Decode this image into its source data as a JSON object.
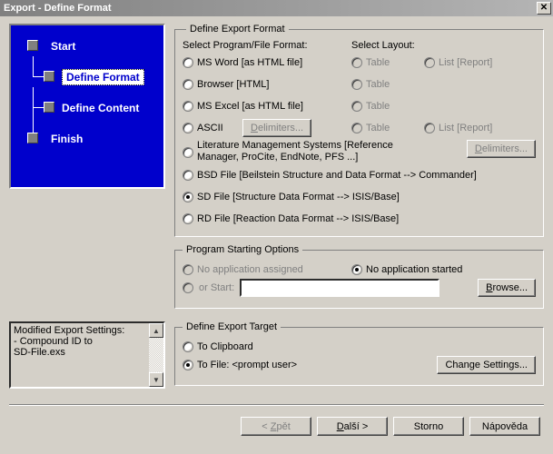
{
  "title": "Export - Define Format",
  "wizard": {
    "items": [
      {
        "label": "Start",
        "sub": false,
        "selected": false
      },
      {
        "label": "Define Format",
        "sub": true,
        "selected": true
      },
      {
        "label": "Define Content",
        "sub": true,
        "selected": false
      },
      {
        "label": "Finish",
        "sub": false,
        "selected": false
      }
    ]
  },
  "format": {
    "legend": "Define Export Format",
    "header_program": "Select Program/File Format:",
    "header_layout": "Select Layout:",
    "rows": {
      "msword": "MS Word [as HTML file]",
      "browser": "Browser [HTML]",
      "msexcel": "MS Excel [as HTML file]",
      "ascii": "ASCII",
      "lit": "Literature Management Systems [Reference Manager, ProCite, EndNote, PFS ...]",
      "bsd": "BSD File [Beilstein Structure and Data Format --> Commander]",
      "sd": "SD File [Structure Data Format --> ISIS/Base]",
      "rd": "RD File [Reaction Data Format --> ISIS/Base]"
    },
    "layout": {
      "table": "Table",
      "list_report": "List [Report]"
    },
    "buttons": {
      "delimiters": "Delimiters..."
    },
    "selected": "sd"
  },
  "program_options": {
    "legend": "Program Starting Options",
    "no_assigned": "No application assigned",
    "no_started": "No application started",
    "or_start": "or Start:",
    "browse": "Browse...",
    "start_value": "",
    "selected": "no_started"
  },
  "settings_text": "Modified Export Settings:\n - Compound ID to\nSD-File.exs",
  "target": {
    "legend": "Define Export Target",
    "to_clipboard": "To Clipboard",
    "to_file": "To File: <prompt user>",
    "change_settings": "Change Settings...",
    "selected": "to_file"
  },
  "footer": {
    "back": "< Zpět",
    "next": "Další >",
    "cancel": "Storno",
    "help": "Nápověda"
  }
}
